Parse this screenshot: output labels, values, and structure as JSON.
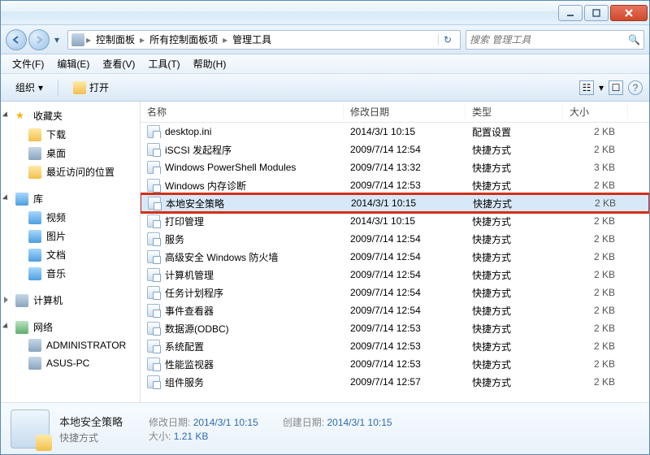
{
  "breadcrumb": [
    "控制面板",
    "所有控制面板项",
    "管理工具"
  ],
  "search_placeholder": "搜索 管理工具",
  "menus": {
    "file": "文件(F)",
    "edit": "编辑(E)",
    "view": "查看(V)",
    "tools": "工具(T)",
    "help": "帮助(H)"
  },
  "toolbar": {
    "organize": "组织",
    "open": "打开"
  },
  "sidebar": {
    "favorites": {
      "head": "收藏夹",
      "items": [
        "下载",
        "桌面",
        "最近访问的位置"
      ]
    },
    "libraries": {
      "head": "库",
      "items": [
        "视频",
        "图片",
        "文档",
        "音乐"
      ]
    },
    "computer": {
      "head": "计算机"
    },
    "network": {
      "head": "网络",
      "items": [
        "ADMINISTRATOR",
        "ASUS-PC"
      ]
    }
  },
  "columns": {
    "name": "名称",
    "modified": "修改日期",
    "type": "类型",
    "size": "大小"
  },
  "files": [
    {
      "name": "desktop.ini",
      "modified": "2014/3/1 10:15",
      "type": "配置设置",
      "size": "2 KB"
    },
    {
      "name": "iSCSI 发起程序",
      "modified": "2009/7/14 12:54",
      "type": "快捷方式",
      "size": "2 KB"
    },
    {
      "name": "Windows PowerShell Modules",
      "modified": "2009/7/14 13:32",
      "type": "快捷方式",
      "size": "3 KB"
    },
    {
      "name": "Windows 内存诊断",
      "modified": "2009/7/14 12:53",
      "type": "快捷方式",
      "size": "2 KB"
    },
    {
      "name": "本地安全策略",
      "modified": "2014/3/1 10:15",
      "type": "快捷方式",
      "size": "2 KB"
    },
    {
      "name": "打印管理",
      "modified": "2014/3/1 10:15",
      "type": "快捷方式",
      "size": "2 KB"
    },
    {
      "name": "服务",
      "modified": "2009/7/14 12:54",
      "type": "快捷方式",
      "size": "2 KB"
    },
    {
      "name": "高级安全 Windows 防火墙",
      "modified": "2009/7/14 12:54",
      "type": "快捷方式",
      "size": "2 KB"
    },
    {
      "name": "计算机管理",
      "modified": "2009/7/14 12:54",
      "type": "快捷方式",
      "size": "2 KB"
    },
    {
      "name": "任务计划程序",
      "modified": "2009/7/14 12:54",
      "type": "快捷方式",
      "size": "2 KB"
    },
    {
      "name": "事件查看器",
      "modified": "2009/7/14 12:54",
      "type": "快捷方式",
      "size": "2 KB"
    },
    {
      "name": "数据源(ODBC)",
      "modified": "2009/7/14 12:53",
      "type": "快捷方式",
      "size": "2 KB"
    },
    {
      "name": "系统配置",
      "modified": "2009/7/14 12:53",
      "type": "快捷方式",
      "size": "2 KB"
    },
    {
      "name": "性能监视器",
      "modified": "2009/7/14 12:53",
      "type": "快捷方式",
      "size": "2 KB"
    },
    {
      "name": "组件服务",
      "modified": "2009/7/14 12:57",
      "type": "快捷方式",
      "size": "2 KB"
    }
  ],
  "selected_index": 4,
  "details": {
    "title": "本地安全策略",
    "subtitle": "快捷方式",
    "mod_label": "修改日期:",
    "mod_value": "2014/3/1 10:15",
    "created_label": "创建日期:",
    "created_value": "2014/3/1 10:15",
    "size_label": "大小:",
    "size_value": "1.21 KB"
  }
}
